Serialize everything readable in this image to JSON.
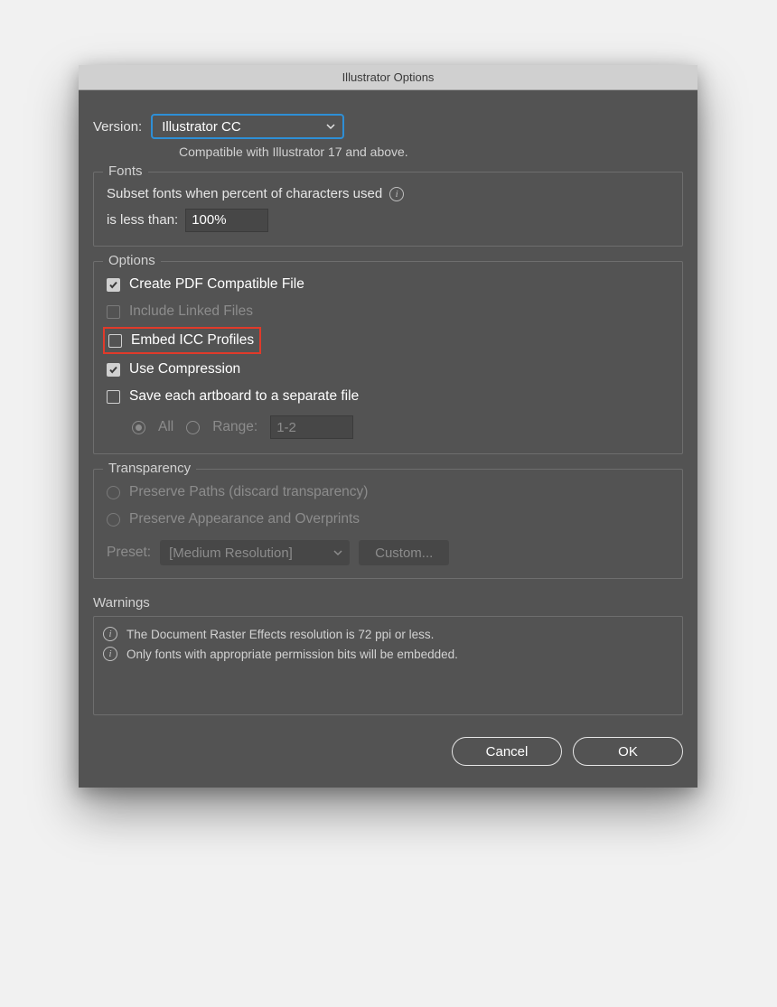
{
  "title": "Illustrator Options",
  "version": {
    "label": "Version:",
    "value": "Illustrator CC",
    "compat": "Compatible with Illustrator 17 and above."
  },
  "fonts": {
    "legend": "Fonts",
    "line1": "Subset fonts when percent of characters used",
    "line2": "is less than:",
    "value": "100%"
  },
  "options": {
    "legend": "Options",
    "create_pdf": "Create PDF Compatible File",
    "include_linked": "Include Linked Files",
    "embed_icc": "Embed ICC Profiles",
    "use_compression": "Use Compression",
    "save_artboards": "Save each artboard to a separate file",
    "all": "All",
    "range": "Range:",
    "range_value": "1-2"
  },
  "transparency": {
    "legend": "Transparency",
    "preserve_paths": "Preserve Paths (discard transparency)",
    "preserve_appear": "Preserve Appearance and Overprints",
    "preset_label": "Preset:",
    "preset_value": "[Medium Resolution]",
    "custom": "Custom..."
  },
  "warnings": {
    "title": "Warnings",
    "w1": "The Document Raster Effects resolution is 72 ppi or less.",
    "w2": "Only fonts with appropriate permission bits will be embedded."
  },
  "buttons": {
    "cancel": "Cancel",
    "ok": "OK"
  }
}
